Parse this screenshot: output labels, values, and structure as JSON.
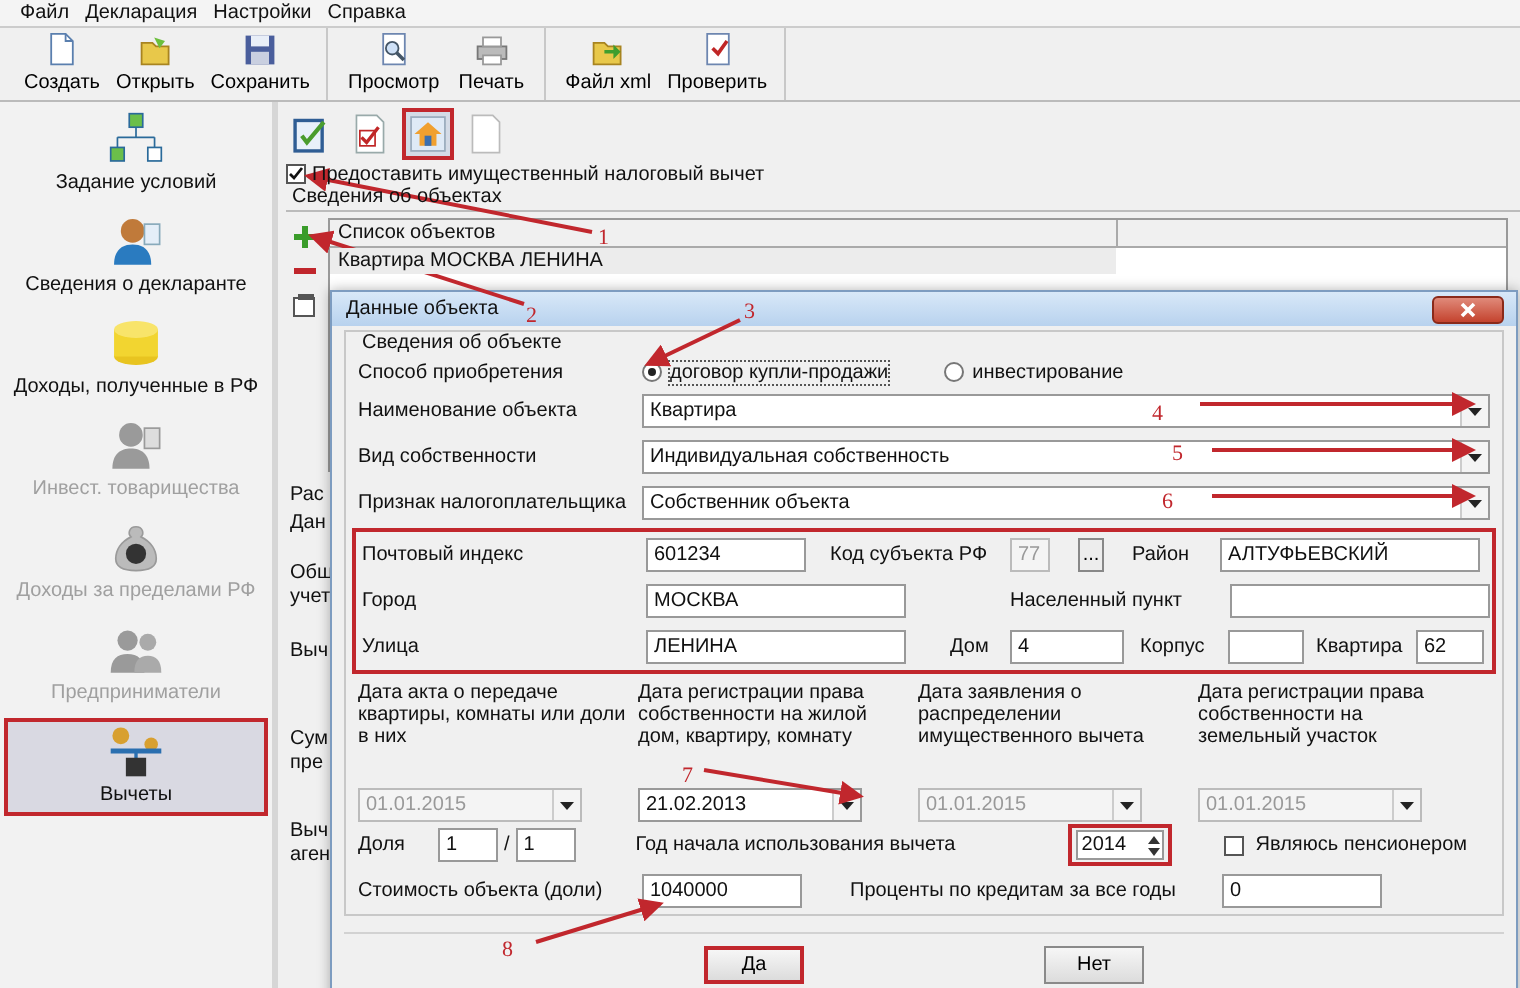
{
  "menu": [
    "Файл",
    "Декларация",
    "Настройки",
    "Справка"
  ],
  "toolbar": [
    [
      {
        "label": "Создать"
      },
      {
        "label": "Открыть"
      },
      {
        "label": "Сохранить"
      }
    ],
    [
      {
        "label": "Просмотр"
      },
      {
        "label": "Печать"
      }
    ],
    [
      {
        "label": "Файл xml"
      },
      {
        "label": "Проверить"
      }
    ]
  ],
  "sidebar": {
    "items": [
      {
        "label": "Задание условий",
        "disabled": false,
        "selected": false,
        "highlighted": false
      },
      {
        "label": "Сведения о декларанте",
        "disabled": false,
        "selected": false,
        "highlighted": false
      },
      {
        "label": "Доходы, полученные в РФ",
        "disabled": false,
        "selected": false,
        "highlighted": false
      },
      {
        "label": "Инвест. товарищества",
        "disabled": true,
        "selected": false,
        "highlighted": false
      },
      {
        "label": "Доходы за пределами РФ",
        "disabled": true,
        "selected": false,
        "highlighted": false
      },
      {
        "label": "Предприниматели",
        "disabled": true,
        "selected": false,
        "highlighted": false
      },
      {
        "label": "Вычеты",
        "disabled": false,
        "selected": true,
        "highlighted": true
      }
    ]
  },
  "section_tabs": [
    {
      "selected": false,
      "highlighted": false
    },
    {
      "selected": false,
      "highlighted": false
    },
    {
      "selected": true,
      "highlighted": true
    },
    {
      "selected": false,
      "highlighted": false
    }
  ],
  "deduction_checkbox": {
    "label": "Предоставить имущественный налоговый вычет",
    "checked": true
  },
  "objects_group": {
    "title": "Сведения об объектах",
    "columns": [
      "Список объектов"
    ],
    "rows": [
      "Квартира МОСКВА  ЛЕНИНА"
    ]
  },
  "background_labels": [
    [
      "Рас"
    ],
    [
      "Дан"
    ],
    [
      "Общ",
      "учет"
    ],
    [
      "Выч"
    ],
    [
      "Сум",
      "пре"
    ],
    [
      "Выч",
      "аген"
    ]
  ],
  "dialog": {
    "title": "Данные объекта",
    "group_title": "Сведения об объекте",
    "acquisition": {
      "label": "Способ приобретения",
      "options": [
        {
          "label": "договор купли-продажи",
          "selected": true
        },
        {
          "label": "инвестирование",
          "selected": false
        }
      ]
    },
    "combos": [
      {
        "label": "Наименование объекта",
        "value": "Квартира"
      },
      {
        "label": "Вид собственности",
        "value": "Индивидуальная собственность"
      },
      {
        "label": "Признак налогоплательщика",
        "value": "Собственник объекта"
      }
    ],
    "address": {
      "highlighted": true,
      "postal_code": {
        "label": "Почтовый индекс",
        "value": "601234"
      },
      "region_code": {
        "label": "Код субъекта РФ",
        "value": "77",
        "disabled": true
      },
      "picker_button": "...",
      "district": {
        "label": "Район",
        "value": "АЛТУФЬЕВСКИЙ"
      },
      "city": {
        "label": "Город",
        "value": "МОСКВА"
      },
      "locality": {
        "label": "Населенный пункт"
      },
      "street": {
        "label": "Улица",
        "value": "ЛЕНИНА"
      },
      "house": {
        "label": "Дом",
        "value": "4"
      },
      "building": {
        "label": "Корпус"
      },
      "apartment": {
        "label": "Квартира",
        "value": "62"
      }
    },
    "dates": [
      {
        "label": "Дата акта о передаче квартиры, комнаты или доли в них",
        "value": "01.01.2015",
        "disabled": true
      },
      {
        "label": "Дата регистрации права собственности на жилой дом, квартиру, комнату",
        "value": "21.02.2013",
        "disabled": false
      },
      {
        "label": "Дата заявления о распределении имущественного вычета",
        "value": "01.01.2015",
        "disabled": true
      },
      {
        "label": "Дата регистрации права собственности на земельный участок",
        "value": "01.01.2015",
        "disabled": true
      }
    ],
    "share": {
      "label": "Доля",
      "numerator": "1",
      "separator": "/",
      "denominator": "1"
    },
    "start_year": {
      "label": "Год начала использования вычета",
      "value": "2014",
      "highlighted": true
    },
    "pensioner": {
      "label": "Являюсь пенсионером",
      "checked": false
    },
    "cost": {
      "label": "Стоимость объекта (доли)",
      "value": "1040000"
    },
    "interest": {
      "label": "Проценты по кредитам за все годы",
      "value": "0"
    },
    "buttons": [
      {
        "label": "Да",
        "highlighted": true
      },
      {
        "label": "Нет",
        "highlighted": false
      }
    ]
  },
  "annotations": [
    {
      "label": "1"
    },
    {
      "label": "2"
    },
    {
      "label": "3"
    },
    {
      "label": "4"
    },
    {
      "label": "5"
    },
    {
      "label": "6"
    },
    {
      "label": "7"
    },
    {
      "label": "8"
    }
  ]
}
